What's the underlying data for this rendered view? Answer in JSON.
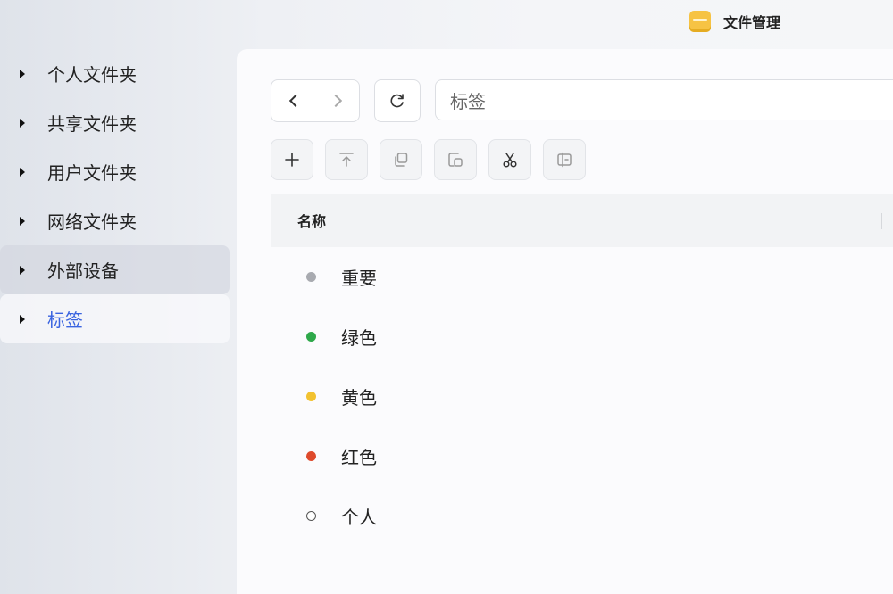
{
  "window": {
    "title": "文件管理",
    "icon": "folder-app-icon"
  },
  "sidebar": {
    "items": [
      {
        "label": "个人文件夹"
      },
      {
        "label": "共享文件夹"
      },
      {
        "label": "用户文件夹"
      },
      {
        "label": "网络文件夹"
      },
      {
        "label": "外部设备",
        "state": "hover"
      },
      {
        "label": "标签",
        "state": "active"
      }
    ],
    "active_color": "#3a64e0"
  },
  "toolbar": {
    "back_icon": "chevron-left-icon",
    "forward_icon": "chevron-right-icon",
    "refresh_icon": "refresh-icon",
    "path_value": "标签",
    "actions": [
      "plus-icon",
      "upload-icon",
      "copy-icon",
      "paste-icon",
      "cut-icon",
      "move-icon"
    ]
  },
  "list": {
    "column_name": "名称",
    "rows": [
      {
        "label": "重要",
        "color": "#a8aab0"
      },
      {
        "label": "绿色",
        "color": "#2ea84a"
      },
      {
        "label": "黄色",
        "color": "#f2c230"
      },
      {
        "label": "红色",
        "color": "#de4a2c"
      },
      {
        "label": "个人",
        "color": "hollow"
      }
    ]
  }
}
